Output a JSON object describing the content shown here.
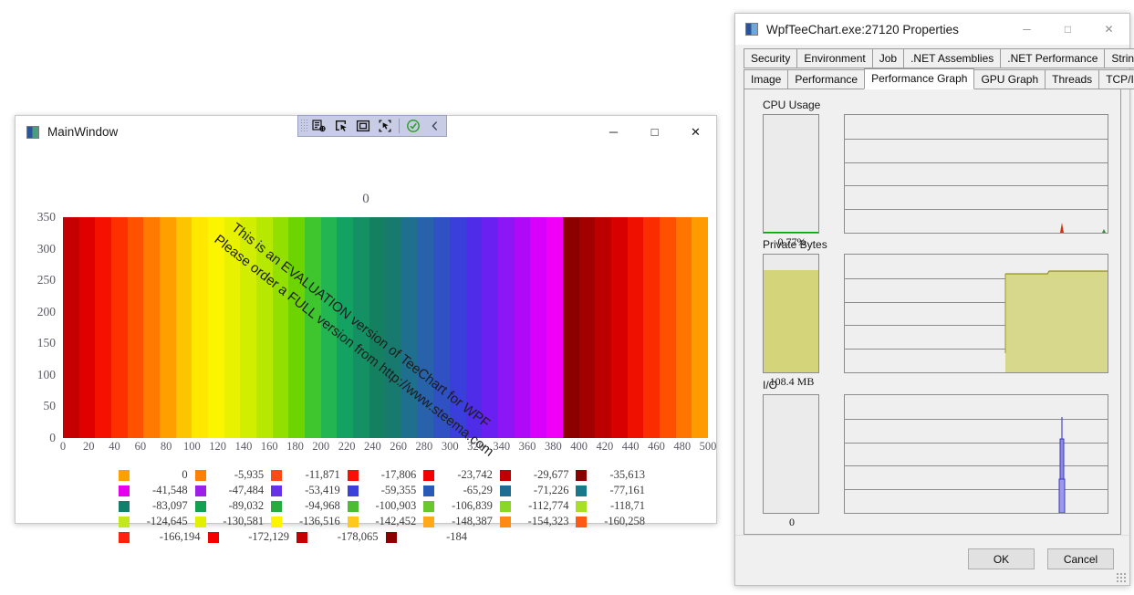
{
  "main_window": {
    "title": "MainWindow",
    "icon": "app-icon",
    "window_controls": {
      "minimize": "─",
      "maximize": "□",
      "close": "✕"
    },
    "vs_toolbar": {
      "icons": [
        "go-to-live-visual-tree-icon",
        "enable-selection-icon",
        "display-layout-adorners-icon",
        "track-focused-element-icon",
        "status-ok-icon",
        "collapse-icon"
      ]
    },
    "watermark": {
      "line1": "This is an EVALUATION version of TeeChart for WPF",
      "line2": "Please order a FULL version from http://www.steema.com"
    }
  },
  "chart_data": {
    "type": "heatmap",
    "title": "0",
    "xlabel": "",
    "ylabel": "",
    "xlim": [
      0,
      500
    ],
    "ylim": [
      0,
      350
    ],
    "grid": false,
    "legend_position": "bottom",
    "xticks": [
      0,
      20,
      40,
      60,
      80,
      100,
      120,
      140,
      160,
      180,
      200,
      220,
      240,
      260,
      280,
      300,
      320,
      340,
      360,
      380,
      400,
      420,
      440,
      460,
      480,
      500
    ],
    "yticks": [
      0,
      50,
      100,
      150,
      200,
      250,
      300,
      350
    ],
    "band_colors": [
      "#c40000",
      "#e00000",
      "#f51000",
      "#ff3000",
      "#ff5200",
      "#ff7a00",
      "#ffa000",
      "#ffc400",
      "#ffe800",
      "#fbf500",
      "#e8f200",
      "#d2ee00",
      "#b6e800",
      "#93e000",
      "#6ed400",
      "#3fc52e",
      "#22b552",
      "#14a263",
      "#149064",
      "#15805f",
      "#187a6e",
      "#1f6f8e",
      "#2762ab",
      "#2f51c4",
      "#3a3fdb",
      "#4f2ce8",
      "#6a20f0",
      "#8c16f5",
      "#b009f8",
      "#d800fb",
      "#f000f5",
      "#8c0000",
      "#a20000",
      "#bc0000",
      "#d80000",
      "#f01000",
      "#fa2d00",
      "#ff5000",
      "#ff7500",
      "#ff9b00"
    ],
    "legend_entries": [
      {
        "color": "#ffa000",
        "value": "0"
      },
      {
        "color": "#ff8000",
        "value": "-5,935"
      },
      {
        "color": "#ff4a14",
        "value": "-11,871"
      },
      {
        "color": "#fa1000",
        "value": "-17,806"
      },
      {
        "color": "#f50000",
        "value": "-23,742"
      },
      {
        "color": "#c00000",
        "value": "-29,677"
      },
      {
        "color": "#8c0000",
        "value": "-35,613"
      },
      {
        "color": "#e600ef",
        "value": "-41,548"
      },
      {
        "color": "#9c20e8",
        "value": "-47,484"
      },
      {
        "color": "#6632e8",
        "value": "-53,419"
      },
      {
        "color": "#3a40d8",
        "value": "-59,355"
      },
      {
        "color": "#2a5ab8",
        "value": "-65,29"
      },
      {
        "color": "#1f6d92",
        "value": "-71,226"
      },
      {
        "color": "#17798a",
        "value": "-77,161"
      },
      {
        "color": "#10806a",
        "value": "-83,097"
      },
      {
        "color": "#12a150",
        "value": "-89,032"
      },
      {
        "color": "#26ab3c",
        "value": "-94,968"
      },
      {
        "color": "#4cbc32",
        "value": "-100,903"
      },
      {
        "color": "#6ac82c",
        "value": "-106,839"
      },
      {
        "color": "#8ad629",
        "value": "-112,774"
      },
      {
        "color": "#a8e024",
        "value": "-118,71"
      },
      {
        "color": "#c2e81c",
        "value": "-124,645"
      },
      {
        "color": "#e0f000",
        "value": "-130,581"
      },
      {
        "color": "#fcf400",
        "value": "-136,516"
      },
      {
        "color": "#ffc81a",
        "value": "-142,452"
      },
      {
        "color": "#ffa81a",
        "value": "-148,387"
      },
      {
        "color": "#ff8a12",
        "value": "-154,323"
      },
      {
        "color": "#ff5a14",
        "value": "-160,258"
      },
      {
        "color": "#ff2010",
        "value": "-166,194"
      },
      {
        "color": "#f50000",
        "value": "-172,129"
      },
      {
        "color": "#c40000",
        "value": "-178,065"
      },
      {
        "color": "#8c0000",
        "value": "-184"
      }
    ]
  },
  "properties_window": {
    "title": "WpfTeeChart.exe:27120 Properties",
    "icon": "app-icon",
    "window_controls": {
      "minimize": "─",
      "maximize": "□",
      "close": "✕"
    },
    "tabs_row1": [
      "Security",
      "Environment",
      "Job",
      ".NET Assemblies",
      ".NET Performance",
      "Strings"
    ],
    "tabs_row2": [
      "Image",
      "Performance",
      "Performance Graph",
      "GPU Graph",
      "Threads",
      "TCP/IP"
    ],
    "active_tab": "Performance Graph",
    "metrics": [
      {
        "label": "CPU Usage",
        "value": "0.77%",
        "fill_percent": 1,
        "fill_color": "#00a000"
      },
      {
        "label": "Private Bytes",
        "value": "108.4 MB",
        "fill_percent": 86,
        "fill_color": "#d4d47a"
      },
      {
        "label": "I/O",
        "value": "0",
        "fill_percent": 0,
        "fill_color": "#4a4ad0"
      }
    ],
    "buttons": {
      "ok": "OK",
      "cancel": "Cancel"
    }
  }
}
